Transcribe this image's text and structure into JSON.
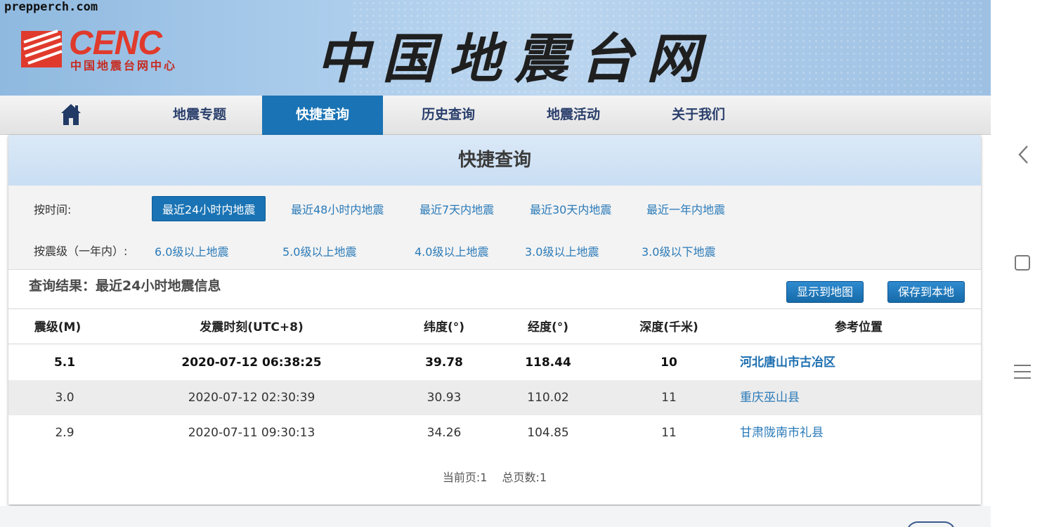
{
  "watermark": "prepperch.com",
  "header": {
    "logo_text": "CENC",
    "logo_subtitle": "中国地震台网中心",
    "site_title": "中国地震台网"
  },
  "nav": {
    "items": [
      {
        "label": "地震专题"
      },
      {
        "label": "快捷查询"
      },
      {
        "label": "历史查询"
      },
      {
        "label": "地震活动"
      },
      {
        "label": "关于我们"
      }
    ]
  },
  "panel": {
    "title": "快捷查询",
    "filter_time_label": "按时间:",
    "filter_time": [
      "最近24小时内地震",
      "最近48小时内地震",
      "最近7天内地震",
      "最近30天内地震",
      "最近一年内地震"
    ],
    "filter_mag_label": "按震级（一年内）:",
    "filter_mag": [
      "6.0级以上地震",
      "5.0级以上地震",
      "4.0级以上地震",
      "3.0级以上地震",
      "3.0级以下地震"
    ]
  },
  "results": {
    "title": "查询结果：最近24小时地震信息",
    "btn_map": "显示到地图",
    "btn_save": "保存到本地",
    "columns": [
      "震级(M)",
      "发震时刻(UTC+8)",
      "纬度(°)",
      "经度(°)",
      "深度(千米)",
      "参考位置"
    ],
    "rows": [
      {
        "mag": "5.1",
        "time": "2020-07-12 06:38:25",
        "lat": "39.78",
        "lon": "118.44",
        "depth": "10",
        "loc": "河北唐山市古冶区"
      },
      {
        "mag": "3.0",
        "time": "2020-07-12 02:30:39",
        "lat": "30.93",
        "lon": "110.02",
        "depth": "11",
        "loc": "重庆巫山县"
      },
      {
        "mag": "2.9",
        "time": "2020-07-11 09:30:13",
        "lat": "34.26",
        "lon": "104.85",
        "depth": "11",
        "loc": "甘肃陇南市礼县"
      }
    ],
    "pager_current": "当前页:1",
    "pager_total": "总页数:1"
  },
  "colors": {
    "accent": "#1a73b4",
    "link": "#2a7ab8",
    "logo_red": "#e03a2c"
  }
}
